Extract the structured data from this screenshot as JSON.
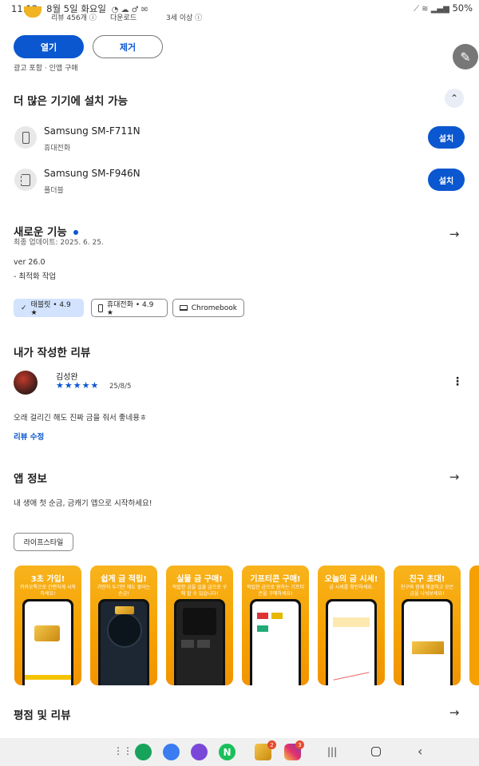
{
  "status_bar": {
    "time": "11:12",
    "date": "8월 5일 화요일",
    "battery": "50%"
  },
  "app_stats": {
    "reviews": "리뷰 456개",
    "downloads": "다운로드",
    "age": "3세 이상"
  },
  "actions": {
    "open": "열기",
    "remove": "제거",
    "ads_note": "광고 포함 · 인앱 구매"
  },
  "devices": {
    "title": "더 많은 기기에 설치 가능",
    "items": [
      {
        "name": "Samsung SM-F711N",
        "type": "휴대전화",
        "button": "설치"
      },
      {
        "name": "Samsung SM-F946N",
        "type": "폴더블",
        "button": "설치"
      }
    ]
  },
  "whats_new": {
    "title": "새로운 기능",
    "updated": "최종 업데이트: 2025. 6. 25.",
    "version": "ver 26.0",
    "note": "- 최적화 작업"
  },
  "chips": [
    {
      "label": "태블릿 • 4.9 ★",
      "icon": "check-icon",
      "selected": true
    },
    {
      "label": "휴대전화 • 4.9 ★",
      "icon": "phone-icon",
      "selected": false
    },
    {
      "label": "Chromebook",
      "icon": "laptop-icon",
      "selected": false
    }
  ],
  "my_review": {
    "title": "내가 작성한 리뷰",
    "author": "김성완",
    "stars": "★★★★★",
    "date": "25/8/5",
    "text": "오래 걸리긴 해도 진짜 금을 줘서 좋네용ㅎ",
    "edit": "리뷰 수정"
  },
  "app_info": {
    "title": "앱 정보",
    "desc": "내 생애 첫 순금, 금캐기 앱으로 시작하세요!",
    "tag": "라이프스타일"
  },
  "screenshots": [
    {
      "title": "3초 가입!",
      "sub": "카카오톡으로 간편하게 시작하세요!"
    },
    {
      "title": "쉽게 금 적립!",
      "sub": "가만히 두기만 해도 쌓이는 순금!"
    },
    {
      "title": "실물 금 구매!",
      "sub": "적립한 금을 실물 금으로 구매 할 수 있습니다!"
    },
    {
      "title": "기프티콘 구매!",
      "sub": "적립한 금으로 원하는 기프티콘을 구매하세요!"
    },
    {
      "title": "오늘의 금 시세!",
      "sub": "금 시세를 확인하세요."
    },
    {
      "title": "친구 초대!",
      "sub": "친구와 함께 채굴하고 모은 금을 나눠보세요!"
    }
  ],
  "ratings": {
    "title": "평점 및 리뷰"
  },
  "colors": {
    "accent": "#0b57d0",
    "chip_selected": "#d3e3fd",
    "gold": "#f5a000"
  },
  "nav_badges": {
    "gold_app": "2",
    "instagram": "3"
  }
}
